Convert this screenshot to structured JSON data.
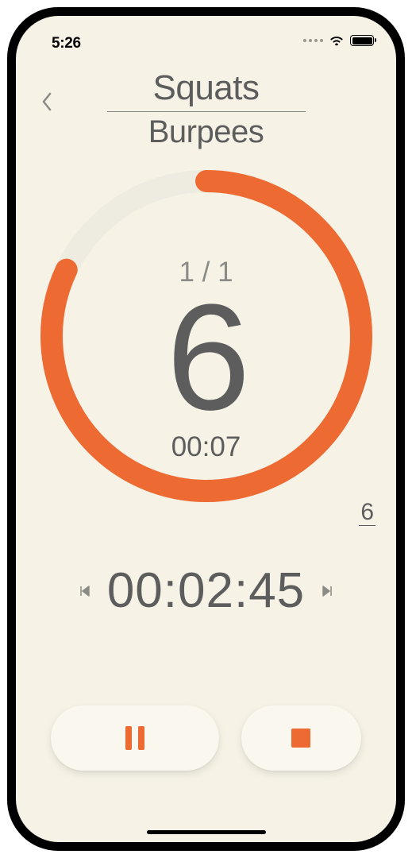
{
  "status": {
    "time": "5:26"
  },
  "header": {
    "current_exercise": "Squats",
    "next_exercise": "Burpees"
  },
  "ring": {
    "set_progress": "1 / 1",
    "countdown": "6",
    "interval_time": "00:07",
    "progress_fraction": 0.82
  },
  "side_counter": "6",
  "elapsed": "00:02:45",
  "colors": {
    "accent": "#ee6a33",
    "track": "#eeece0",
    "text": "#5d5d5d"
  }
}
